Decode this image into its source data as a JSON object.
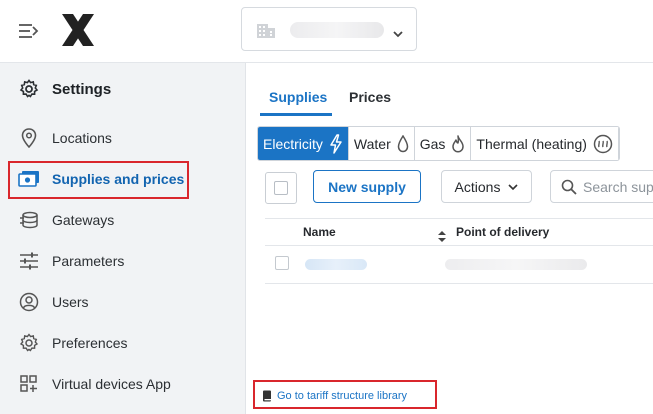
{
  "header": {
    "menu_icon": "collapse-menu-icon",
    "logo_icon": "x-logo-icon",
    "site_selector": {
      "icon": "building-icon",
      "value": "",
      "chevron": "chevron-down-icon"
    }
  },
  "sidebar": {
    "title": "Settings",
    "title_icon": "gear-icon",
    "items": [
      {
        "label": "Locations",
        "icon": "location-pin-icon"
      },
      {
        "label": "Supplies and prices",
        "icon": "money-icon",
        "active": true
      },
      {
        "label": "Gateways",
        "icon": "gateway-icon"
      },
      {
        "label": "Parameters",
        "icon": "sliders-icon"
      },
      {
        "label": "Users",
        "icon": "user-icon"
      },
      {
        "label": "Preferences",
        "icon": "gear-icon"
      },
      {
        "label": "Virtual devices App",
        "icon": "apps-icon"
      }
    ]
  },
  "main": {
    "tabs": [
      {
        "label": "Supplies",
        "active": true
      },
      {
        "label": "Prices",
        "active": false
      }
    ],
    "supply_types": [
      {
        "label": "Electricity",
        "icon": "bolt-icon",
        "active": true
      },
      {
        "label": "Water",
        "icon": "water-drop-icon",
        "active": false
      },
      {
        "label": "Gas",
        "icon": "flame-icon",
        "active": false
      },
      {
        "label": "Thermal (heating)",
        "icon": "heating-icon",
        "active": false
      }
    ],
    "toolbar": {
      "new_supply_label": "New supply",
      "actions_label": "Actions",
      "search_placeholder": "Search supp"
    },
    "table": {
      "columns": [
        "Name",
        "Point of delivery"
      ],
      "rows": [
        {
          "name": "",
          "point_of_delivery": ""
        }
      ]
    },
    "footer_link": "Go to tariff structure library"
  },
  "colors": {
    "accent": "#1b74c5",
    "highlight": "#d9262c",
    "sidebar_bg": "#f1f3f5"
  }
}
